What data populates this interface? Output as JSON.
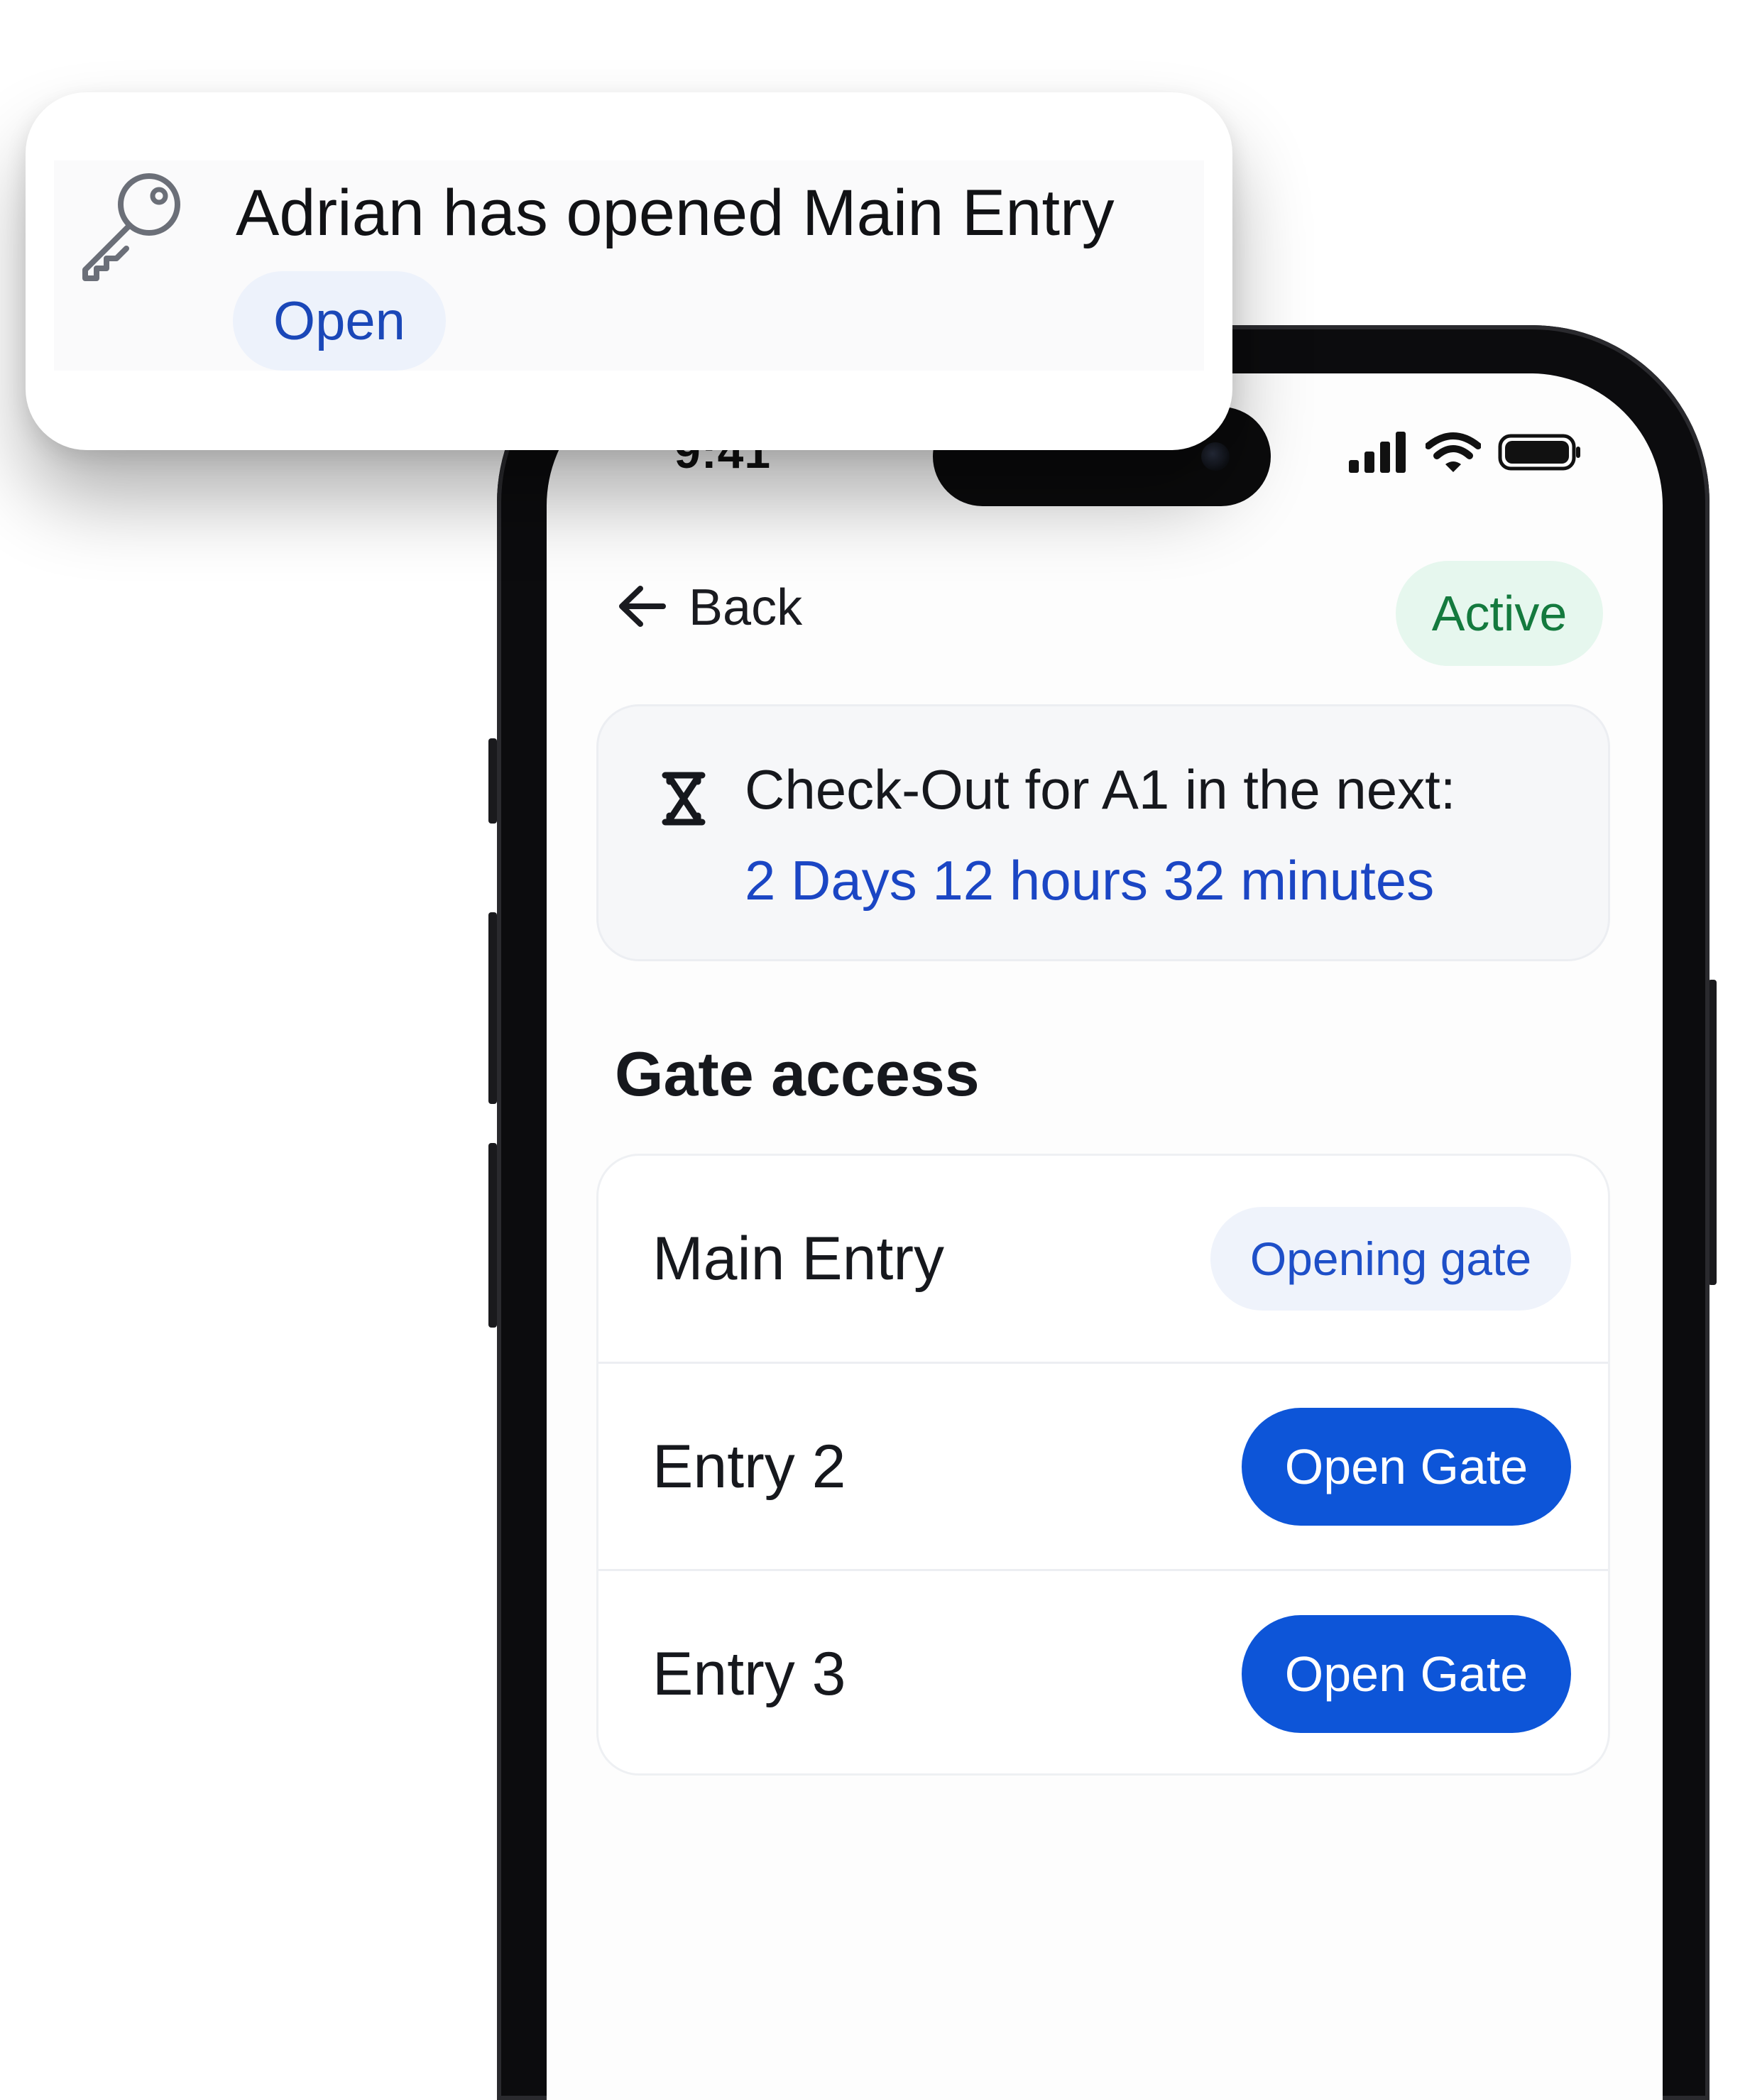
{
  "status_bar": {
    "time": "9:41",
    "icons": [
      "cellular-signal-icon",
      "wifi-icon",
      "battery-icon"
    ]
  },
  "header": {
    "back_label": "Back",
    "status_badge": "Active"
  },
  "checkout": {
    "label": "Check-Out for A1 in the next:",
    "remaining": "2 Days 12 hours 32 minutes",
    "icon": "hourglass-icon"
  },
  "gate_access": {
    "title": "Gate access",
    "gates": [
      {
        "name": "Main Entry",
        "state_label": "Opening gate"
      },
      {
        "name": "Entry 2",
        "action_label": "Open Gate"
      },
      {
        "name": "Entry 3",
        "action_label": "Open Gate"
      }
    ]
  },
  "notification": {
    "icon": "key-icon",
    "message": "Adrian has opened Main Entry",
    "action_label": "Open"
  },
  "colors": {
    "primary_blue": "#0d55d8",
    "link_blue": "#1b46c4",
    "active_green": "#147a3e",
    "active_green_bg": "#e6f7ee"
  }
}
